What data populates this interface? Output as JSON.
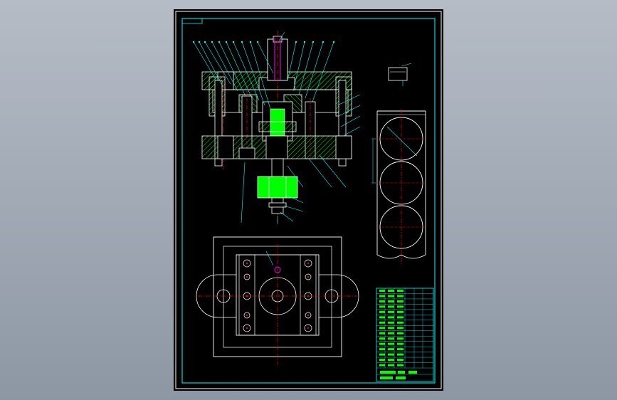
{
  "viewport": {
    "background_top": "#b5bcc6",
    "background_bottom": "#8d97a4"
  },
  "drawing": {
    "sheet_color": "#000000",
    "colors": {
      "frame": "#ffffff",
      "border": "#00ffff",
      "outline": "#ffffff",
      "hatch": "#00ff00",
      "solid_part": "#00ff00",
      "centerline": "#ff0000",
      "leader": "#00ffff",
      "spring": "#ff00ff",
      "title_block_lines": "#00ffff",
      "title_block_text": "#00ff00"
    },
    "views": [
      "section-view",
      "top-view",
      "strip-layout",
      "part-detail"
    ],
    "title_block": {
      "rows": 15,
      "columns": 6
    }
  }
}
